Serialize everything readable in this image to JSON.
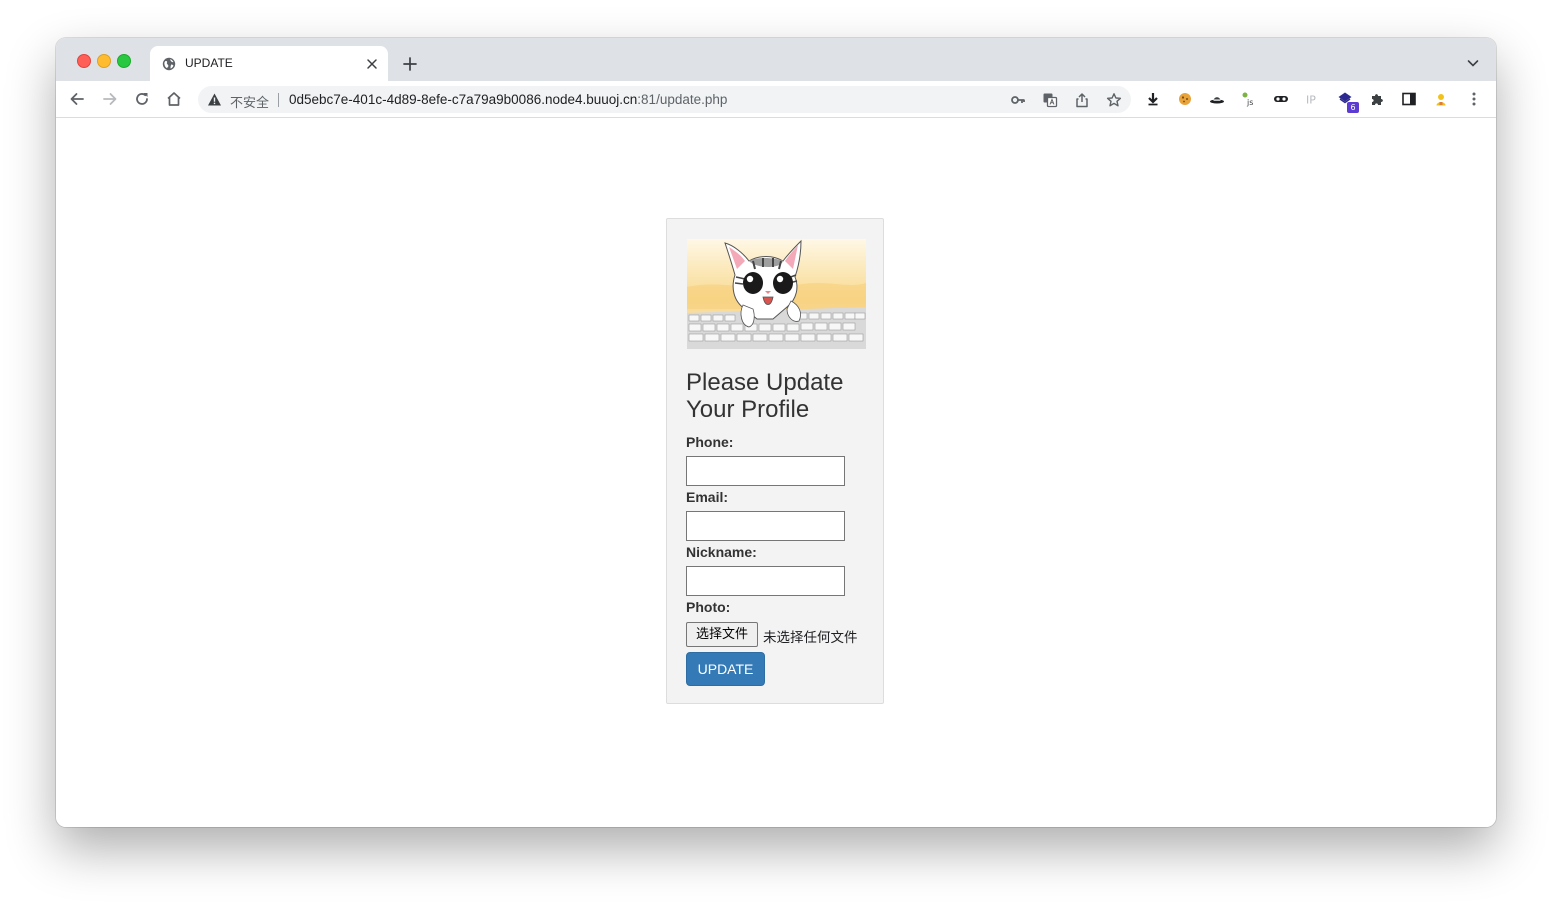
{
  "browser": {
    "tab_title": "UPDATE",
    "security_label": "不安全",
    "url_host": "0d5ebc7e-401c-4d89-8efe-c7a79a9b0086.node4.buuoj.cn",
    "url_rest": ":81/update.php",
    "extension_badge": "6"
  },
  "form": {
    "heading": "Please Update Your Profile",
    "phone_label": "Phone:",
    "email_label": "Email:",
    "nickname_label": "Nickname:",
    "photo_label": "Photo:",
    "file_button": "选择文件",
    "file_status": "未选择任何文件",
    "submit_label": "UPDATE",
    "phone_value": "",
    "email_value": "",
    "nickname_value": ""
  },
  "icons": {
    "back": "back-arrow-icon",
    "forward": "forward-arrow-icon",
    "reload": "reload-icon",
    "home": "home-icon",
    "warning": "warning-icon",
    "key": "key-icon",
    "translate": "translate-icon",
    "share": "share-icon",
    "bookmark": "star-icon",
    "extensions": "puzzle-icon"
  },
  "colors": {
    "accent": "#337ab7",
    "card_bg": "#f3f3f3",
    "tabstrip": "#dee1e6"
  }
}
